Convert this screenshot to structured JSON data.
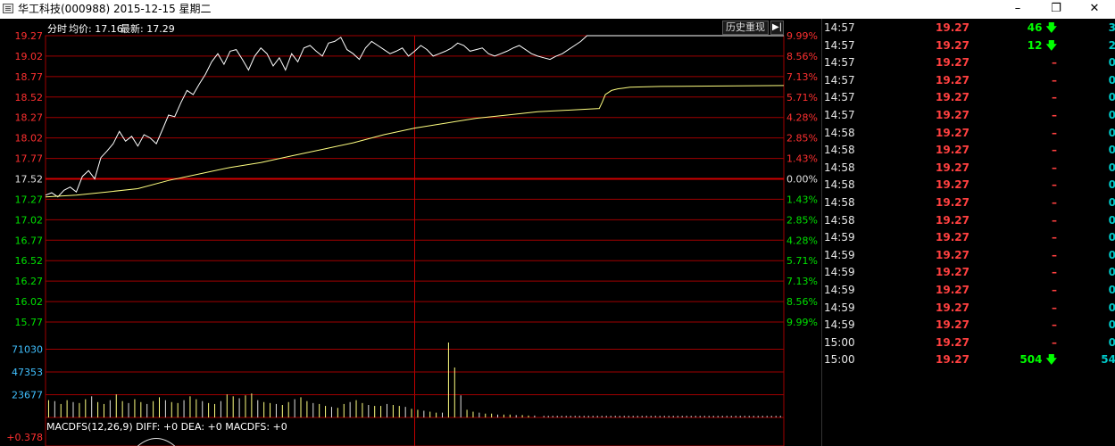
{
  "window": {
    "title": "华工科技(000988) 2015-12-15 星期二",
    "minimize_icon": "minimize-icon",
    "restore_icon": "restore-icon",
    "close_icon": "close-icon"
  },
  "colors": {
    "background": "#000000",
    "up_red": "#ff3030",
    "down_green": "#00e000",
    "price_line": "#ffffff",
    "avg_line": "#ffff80",
    "grid_red": "#a00000",
    "volume_cyan": "#40c0ff"
  },
  "chart_header": {
    "label": "分时",
    "avg_label": "均价:",
    "avg_value": "17.16",
    "last_label": "最新:",
    "last_value": "17.29"
  },
  "history_button": {
    "label": "历史重现",
    "arrow_icon": "skip-forward-icon"
  },
  "macd_header": "MACDFS(12,26,9) DIFF: +0 DEA: +0 MACDFS: +0",
  "macd_axis_label": "+0.378",
  "chart_data": {
    "type": "line",
    "prev_close": 17.52,
    "ylim": [
      15.77,
      19.27
    ],
    "price_ticks": [
      "19.27",
      "19.02",
      "18.77",
      "18.52",
      "18.27",
      "18.02",
      "17.77",
      "17.52",
      "17.27",
      "17.02",
      "16.77",
      "16.52",
      "16.27",
      "16.02",
      "15.77"
    ],
    "pct_ticks": [
      "9.99%",
      "8.56%",
      "7.13%",
      "5.71%",
      "4.28%",
      "2.85%",
      "1.43%",
      "0.00%",
      "1.43%",
      "2.85%",
      "4.28%",
      "5.71%",
      "7.13%",
      "8.56%",
      "9.99%"
    ],
    "volume_ticks": [
      "71030",
      "47353",
      "23677"
    ],
    "series": [
      {
        "name": "最新",
        "x": [
          0,
          2,
          4,
          6,
          8,
          10,
          12,
          14,
          16,
          18,
          20,
          22,
          24,
          26,
          28,
          30,
          32,
          34,
          36,
          38,
          40,
          42,
          44,
          46,
          48,
          50,
          52,
          54,
          56,
          58,
          60,
          62,
          64,
          66,
          68,
          70,
          72,
          74,
          76,
          78,
          80,
          82,
          84,
          86,
          88,
          90,
          92,
          94,
          96,
          98,
          100,
          102,
          104,
          106,
          108,
          110,
          112,
          114,
          116,
          118,
          120,
          122,
          124,
          126,
          128,
          130,
          132,
          134,
          136,
          138,
          140,
          142,
          144,
          146,
          148,
          150,
          152,
          154,
          156,
          158,
          160,
          162,
          164,
          166,
          168,
          170,
          172,
          174,
          176,
          178,
          180,
          182,
          184,
          186,
          188,
          190,
          240
        ],
        "values": [
          17.32,
          17.35,
          17.3,
          17.38,
          17.42,
          17.36,
          17.55,
          17.62,
          17.52,
          17.78,
          17.86,
          17.95,
          18.1,
          17.98,
          18.04,
          17.92,
          18.06,
          18.02,
          17.95,
          18.12,
          18.3,
          18.28,
          18.45,
          18.6,
          18.55,
          18.68,
          18.8,
          18.95,
          19.05,
          18.92,
          19.08,
          19.1,
          18.98,
          18.85,
          19.02,
          19.12,
          19.05,
          18.9,
          19.0,
          18.85,
          19.05,
          18.95,
          19.12,
          19.15,
          19.08,
          19.02,
          19.18,
          19.2,
          19.25,
          19.1,
          19.05,
          18.98,
          19.12,
          19.2,
          19.15,
          19.1,
          19.05,
          19.08,
          19.12,
          19.02,
          19.08,
          19.15,
          19.1,
          19.02,
          19.05,
          19.08,
          19.12,
          19.18,
          19.15,
          19.08,
          19.1,
          19.12,
          19.05,
          19.02,
          19.05,
          19.08,
          19.12,
          19.15,
          19.1,
          19.05,
          19.02,
          19.0,
          18.98,
          19.02,
          19.05,
          19.1,
          19.15,
          19.2,
          19.27,
          19.27,
          19.27,
          19.27,
          19.27,
          19.27,
          19.27,
          19.27,
          19.27
        ]
      },
      {
        "name": "均价",
        "x": [
          0,
          10,
          20,
          30,
          40,
          50,
          60,
          70,
          80,
          90,
          100,
          110,
          120,
          130,
          140,
          150,
          160,
          170,
          180,
          181,
          182,
          184,
          186,
          188,
          190,
          200,
          240
        ],
        "values": [
          17.3,
          17.32,
          17.36,
          17.4,
          17.5,
          17.58,
          17.66,
          17.72,
          17.8,
          17.88,
          17.96,
          18.06,
          18.14,
          18.2,
          18.26,
          18.3,
          18.34,
          18.36,
          18.38,
          18.46,
          18.55,
          18.6,
          18.62,
          18.63,
          18.64,
          18.65,
          18.66
        ]
      }
    ],
    "volume": [
      18000,
      17000,
      14000,
      18000,
      16000,
      15000,
      19000,
      22000,
      16000,
      14000,
      18000,
      24000,
      17000,
      15000,
      19000,
      16000,
      14000,
      17000,
      21000,
      18000,
      16000,
      15000,
      18000,
      22000,
      19000,
      17000,
      15000,
      14000,
      17000,
      24000,
      22000,
      20000,
      23000,
      25000,
      18000,
      16000,
      15000,
      14000,
      13000,
      16000,
      19000,
      21000,
      17000,
      15000,
      14000,
      12000,
      11000,
      10000,
      14000,
      16000,
      18000,
      15000,
      13000,
      12000,
      12000,
      14000,
      13000,
      12000,
      11000,
      9000,
      8000,
      7000,
      6000,
      5000,
      5000,
      78000,
      52000,
      23000,
      8000,
      6000,
      5000,
      4000,
      4000,
      3000,
      3000,
      3000,
      2500,
      2500,
      2000,
      2000
    ]
  },
  "ticks": {
    "rows": [
      {
        "time": "14:57",
        "price": "19.27",
        "vol": "46",
        "dir": "down",
        "count": "3"
      },
      {
        "time": "14:57",
        "price": "19.27",
        "vol": "12",
        "dir": "down",
        "count": "2"
      },
      {
        "time": "14:57",
        "price": "19.27",
        "vol": "–",
        "dir": "none",
        "count": "0"
      },
      {
        "time": "14:57",
        "price": "19.27",
        "vol": "–",
        "dir": "none",
        "count": "0"
      },
      {
        "time": "14:57",
        "price": "19.27",
        "vol": "–",
        "dir": "none",
        "count": "0"
      },
      {
        "time": "14:57",
        "price": "19.27",
        "vol": "–",
        "dir": "none",
        "count": "0"
      },
      {
        "time": "14:58",
        "price": "19.27",
        "vol": "–",
        "dir": "none",
        "count": "0"
      },
      {
        "time": "14:58",
        "price": "19.27",
        "vol": "–",
        "dir": "none",
        "count": "0"
      },
      {
        "time": "14:58",
        "price": "19.27",
        "vol": "–",
        "dir": "none",
        "count": "0"
      },
      {
        "time": "14:58",
        "price": "19.27",
        "vol": "–",
        "dir": "none",
        "count": "0"
      },
      {
        "time": "14:58",
        "price": "19.27",
        "vol": "–",
        "dir": "none",
        "count": "0"
      },
      {
        "time": "14:58",
        "price": "19.27",
        "vol": "–",
        "dir": "none",
        "count": "0"
      },
      {
        "time": "14:59",
        "price": "19.27",
        "vol": "–",
        "dir": "none",
        "count": "0"
      },
      {
        "time": "14:59",
        "price": "19.27",
        "vol": "–",
        "dir": "none",
        "count": "0"
      },
      {
        "time": "14:59",
        "price": "19.27",
        "vol": "–",
        "dir": "none",
        "count": "0"
      },
      {
        "time": "14:59",
        "price": "19.27",
        "vol": "–",
        "dir": "none",
        "count": "0"
      },
      {
        "time": "14:59",
        "price": "19.27",
        "vol": "–",
        "dir": "none",
        "count": "0"
      },
      {
        "time": "14:59",
        "price": "19.27",
        "vol": "–",
        "dir": "none",
        "count": "0"
      },
      {
        "time": "15:00",
        "price": "19.27",
        "vol": "–",
        "dir": "none",
        "count": "0"
      },
      {
        "time": "15:00",
        "price": "19.27",
        "vol": "504",
        "dir": "down",
        "count": "54"
      }
    ]
  }
}
